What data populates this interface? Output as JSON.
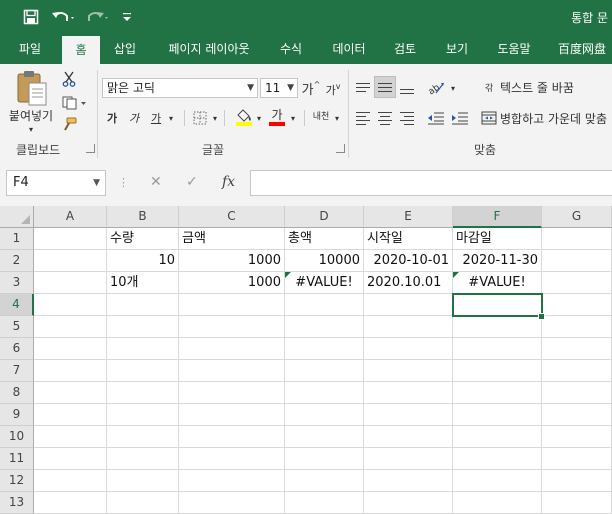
{
  "titlebar": {
    "title": "통합 문",
    "save_icon": "save-icon",
    "undo_icon": "undo-icon",
    "redo_icon": "redo-icon",
    "customize_icon": "customize-qat-icon"
  },
  "tabs": [
    "파일",
    "홈",
    "삽입",
    "페이지 레이아웃",
    "수식",
    "데이터",
    "검토",
    "보기",
    "도움말",
    "百度网盘"
  ],
  "active_tab": "홈",
  "ribbon": {
    "clipboard": {
      "paste_label": "붙여넣기",
      "group_label": "클립보드"
    },
    "font": {
      "font_name": "맑은 고딕",
      "font_size": "11",
      "increase_size": "가",
      "decrease_size": "가",
      "bold": "가",
      "italic": "가",
      "underline": "가",
      "font_color_glyph": "가",
      "phonetic": "내천",
      "group_label": "글꼴",
      "highlight_color": "#ffff00",
      "font_color": "#ff0000"
    },
    "alignment": {
      "wrap_text": "텍스트 줄 바꿈",
      "merge_center": "병합하고 가운데 맞춤",
      "group_label": "맞춤",
      "wrap_glyph": "갂"
    }
  },
  "formula_bar": {
    "name_box": "F4",
    "cancel": "✕",
    "enter": "✓",
    "fx": "fx",
    "formula": ""
  },
  "sheet": {
    "columns": [
      "A",
      "B",
      "C",
      "D",
      "E",
      "F",
      "G"
    ],
    "rows": [
      "1",
      "2",
      "3",
      "4",
      "5",
      "6",
      "7",
      "8",
      "9",
      "10",
      "11",
      "12",
      "13"
    ],
    "selected_column": "F",
    "selected_row": "4",
    "cells": {
      "B1": "수량",
      "C1": "금액",
      "D1": "총액",
      "E1": "시작일",
      "F1": "마감일",
      "B2": "10",
      "C2": "1000",
      "D2": "10000",
      "E2": "2020-10-01",
      "F2": "2020-11-30",
      "B3": "10개",
      "C3": "1000",
      "D3": "#VALUE!",
      "E3": "2020.10.01",
      "F3": "#VALUE!"
    },
    "error_indicator_color": "#1e7145",
    "accent_color": "#217346"
  }
}
